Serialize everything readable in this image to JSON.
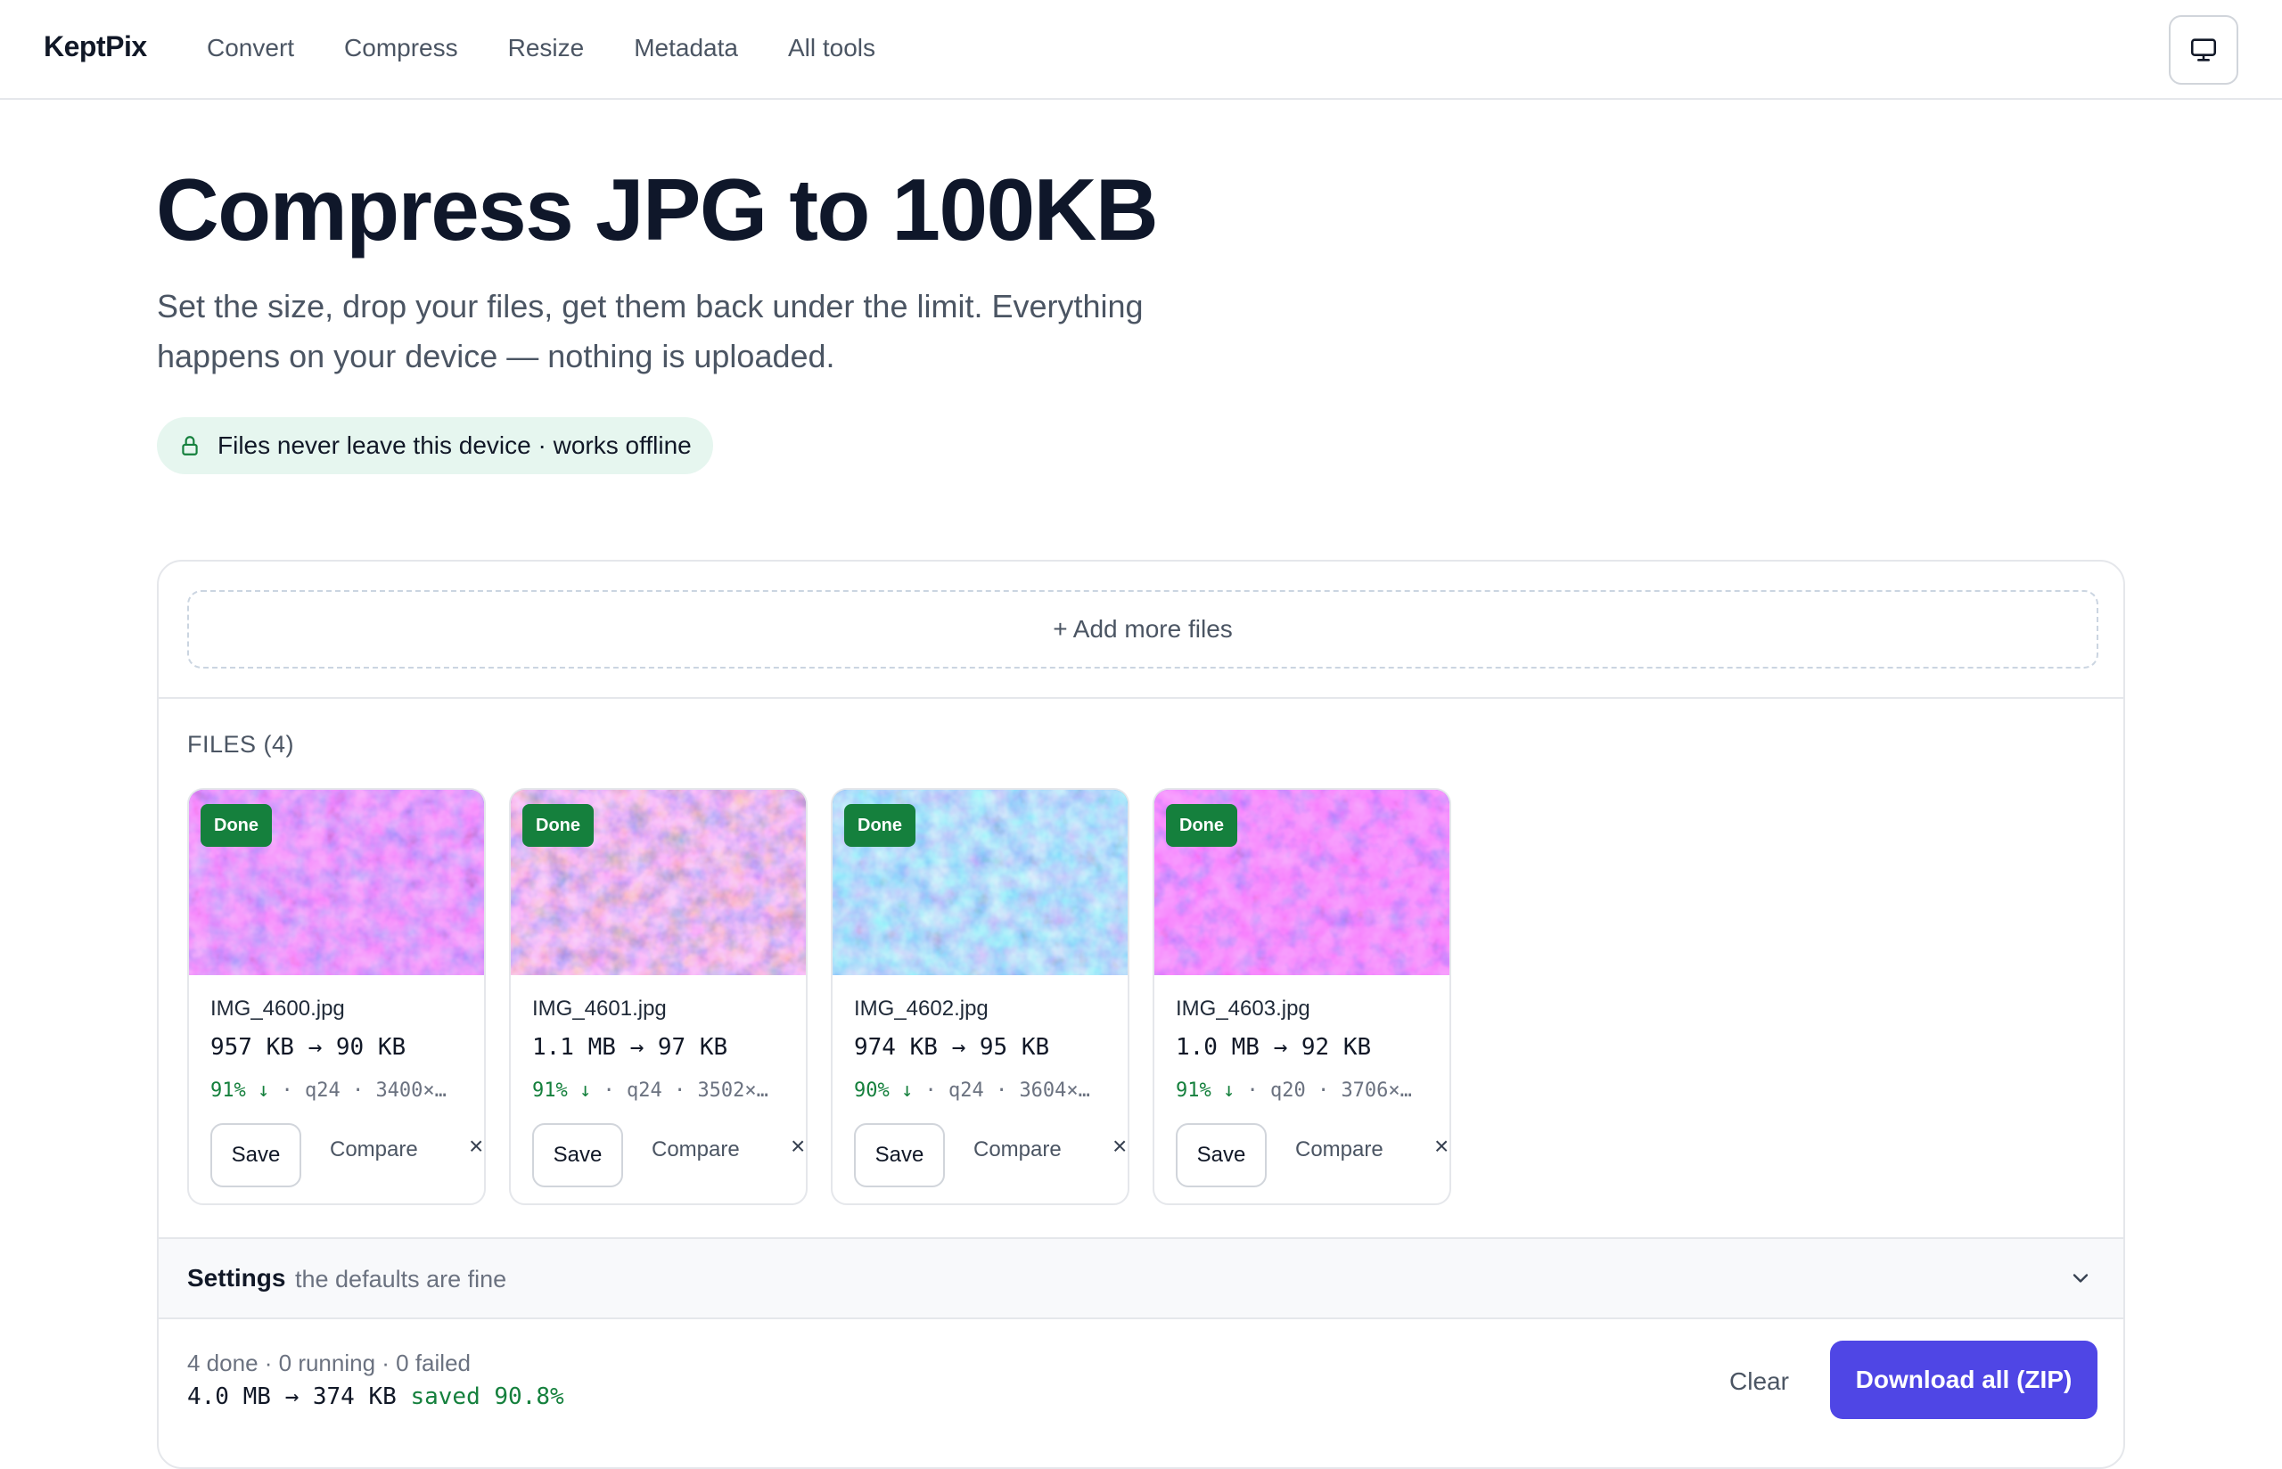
{
  "header": {
    "brand": "KeptPix",
    "nav": [
      "Convert",
      "Compress",
      "Resize",
      "Metadata",
      "All tools"
    ],
    "display_icon": "monitor-icon"
  },
  "hero": {
    "title": "Compress JPG to 100KB",
    "subtitle": "Set the size, drop your files, get them back under the limit. Everything happens on your device — nothing is uploaded.",
    "privacy_badge": "Files never leave this device · works offline",
    "privacy_icon": "lock-icon"
  },
  "dropzone": {
    "label": "+ Add more files"
  },
  "files": {
    "label": "FILES (4)",
    "items": [
      {
        "status": "Done",
        "name": "IMG_4600.jpg",
        "sizes": "957 KB → 90 KB",
        "pct": "91% ↓",
        "rest": " · q24 · 3400×…",
        "save": "Save",
        "compare": "Compare",
        "remove": "×"
      },
      {
        "status": "Done",
        "name": "IMG_4601.jpg",
        "sizes": "1.1 MB → 97 KB",
        "pct": "91% ↓",
        "rest": " · q24 · 3502×…",
        "save": "Save",
        "compare": "Compare",
        "remove": "×"
      },
      {
        "status": "Done",
        "name": "IMG_4602.jpg",
        "sizes": "974 KB → 95 KB",
        "pct": "90% ↓",
        "rest": " · q24 · 3604×…",
        "save": "Save",
        "compare": "Compare",
        "remove": "×"
      },
      {
        "status": "Done",
        "name": "IMG_4603.jpg",
        "sizes": "1.0 MB → 92 KB",
        "pct": "91% ↓",
        "rest": " · q20 · 3706×…",
        "save": "Save",
        "compare": "Compare",
        "remove": "×"
      }
    ]
  },
  "settings": {
    "title": "Settings",
    "hint": "the defaults are fine"
  },
  "footer": {
    "status": "4 done · 0 running · 0 failed",
    "total": "4.0 MB → 374 KB ",
    "saved": "saved 90.8%",
    "clear": "Clear",
    "download": "Download all (ZIP)"
  },
  "colors": {
    "accent": "#4f46e5",
    "success": "#15803d",
    "privacy_bg": "#e6f6ef"
  }
}
